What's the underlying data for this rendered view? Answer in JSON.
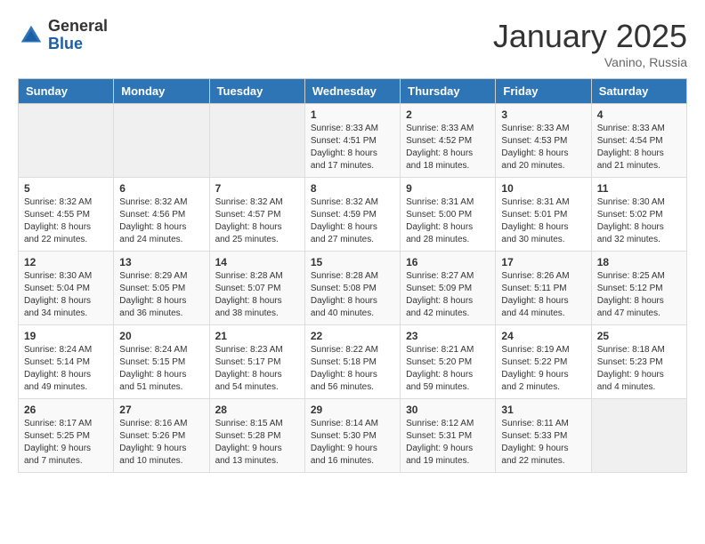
{
  "header": {
    "logo_general": "General",
    "logo_blue": "Blue",
    "month": "January 2025",
    "location": "Vanino, Russia"
  },
  "weekdays": [
    "Sunday",
    "Monday",
    "Tuesday",
    "Wednesday",
    "Thursday",
    "Friday",
    "Saturday"
  ],
  "weeks": [
    [
      {
        "day": "",
        "info": ""
      },
      {
        "day": "",
        "info": ""
      },
      {
        "day": "",
        "info": ""
      },
      {
        "day": "1",
        "info": "Sunrise: 8:33 AM\nSunset: 4:51 PM\nDaylight: 8 hours\nand 17 minutes."
      },
      {
        "day": "2",
        "info": "Sunrise: 8:33 AM\nSunset: 4:52 PM\nDaylight: 8 hours\nand 18 minutes."
      },
      {
        "day": "3",
        "info": "Sunrise: 8:33 AM\nSunset: 4:53 PM\nDaylight: 8 hours\nand 20 minutes."
      },
      {
        "day": "4",
        "info": "Sunrise: 8:33 AM\nSunset: 4:54 PM\nDaylight: 8 hours\nand 21 minutes."
      }
    ],
    [
      {
        "day": "5",
        "info": "Sunrise: 8:32 AM\nSunset: 4:55 PM\nDaylight: 8 hours\nand 22 minutes."
      },
      {
        "day": "6",
        "info": "Sunrise: 8:32 AM\nSunset: 4:56 PM\nDaylight: 8 hours\nand 24 minutes."
      },
      {
        "day": "7",
        "info": "Sunrise: 8:32 AM\nSunset: 4:57 PM\nDaylight: 8 hours\nand 25 minutes."
      },
      {
        "day": "8",
        "info": "Sunrise: 8:32 AM\nSunset: 4:59 PM\nDaylight: 8 hours\nand 27 minutes."
      },
      {
        "day": "9",
        "info": "Sunrise: 8:31 AM\nSunset: 5:00 PM\nDaylight: 8 hours\nand 28 minutes."
      },
      {
        "day": "10",
        "info": "Sunrise: 8:31 AM\nSunset: 5:01 PM\nDaylight: 8 hours\nand 30 minutes."
      },
      {
        "day": "11",
        "info": "Sunrise: 8:30 AM\nSunset: 5:02 PM\nDaylight: 8 hours\nand 32 minutes."
      }
    ],
    [
      {
        "day": "12",
        "info": "Sunrise: 8:30 AM\nSunset: 5:04 PM\nDaylight: 8 hours\nand 34 minutes."
      },
      {
        "day": "13",
        "info": "Sunrise: 8:29 AM\nSunset: 5:05 PM\nDaylight: 8 hours\nand 36 minutes."
      },
      {
        "day": "14",
        "info": "Sunrise: 8:28 AM\nSunset: 5:07 PM\nDaylight: 8 hours\nand 38 minutes."
      },
      {
        "day": "15",
        "info": "Sunrise: 8:28 AM\nSunset: 5:08 PM\nDaylight: 8 hours\nand 40 minutes."
      },
      {
        "day": "16",
        "info": "Sunrise: 8:27 AM\nSunset: 5:09 PM\nDaylight: 8 hours\nand 42 minutes."
      },
      {
        "day": "17",
        "info": "Sunrise: 8:26 AM\nSunset: 5:11 PM\nDaylight: 8 hours\nand 44 minutes."
      },
      {
        "day": "18",
        "info": "Sunrise: 8:25 AM\nSunset: 5:12 PM\nDaylight: 8 hours\nand 47 minutes."
      }
    ],
    [
      {
        "day": "19",
        "info": "Sunrise: 8:24 AM\nSunset: 5:14 PM\nDaylight: 8 hours\nand 49 minutes."
      },
      {
        "day": "20",
        "info": "Sunrise: 8:24 AM\nSunset: 5:15 PM\nDaylight: 8 hours\nand 51 minutes."
      },
      {
        "day": "21",
        "info": "Sunrise: 8:23 AM\nSunset: 5:17 PM\nDaylight: 8 hours\nand 54 minutes."
      },
      {
        "day": "22",
        "info": "Sunrise: 8:22 AM\nSunset: 5:18 PM\nDaylight: 8 hours\nand 56 minutes."
      },
      {
        "day": "23",
        "info": "Sunrise: 8:21 AM\nSunset: 5:20 PM\nDaylight: 8 hours\nand 59 minutes."
      },
      {
        "day": "24",
        "info": "Sunrise: 8:19 AM\nSunset: 5:22 PM\nDaylight: 9 hours\nand 2 minutes."
      },
      {
        "day": "25",
        "info": "Sunrise: 8:18 AM\nSunset: 5:23 PM\nDaylight: 9 hours\nand 4 minutes."
      }
    ],
    [
      {
        "day": "26",
        "info": "Sunrise: 8:17 AM\nSunset: 5:25 PM\nDaylight: 9 hours\nand 7 minutes."
      },
      {
        "day": "27",
        "info": "Sunrise: 8:16 AM\nSunset: 5:26 PM\nDaylight: 9 hours\nand 10 minutes."
      },
      {
        "day": "28",
        "info": "Sunrise: 8:15 AM\nSunset: 5:28 PM\nDaylight: 9 hours\nand 13 minutes."
      },
      {
        "day": "29",
        "info": "Sunrise: 8:14 AM\nSunset: 5:30 PM\nDaylight: 9 hours\nand 16 minutes."
      },
      {
        "day": "30",
        "info": "Sunrise: 8:12 AM\nSunset: 5:31 PM\nDaylight: 9 hours\nand 19 minutes."
      },
      {
        "day": "31",
        "info": "Sunrise: 8:11 AM\nSunset: 5:33 PM\nDaylight: 9 hours\nand 22 minutes."
      },
      {
        "day": "",
        "info": ""
      }
    ]
  ]
}
